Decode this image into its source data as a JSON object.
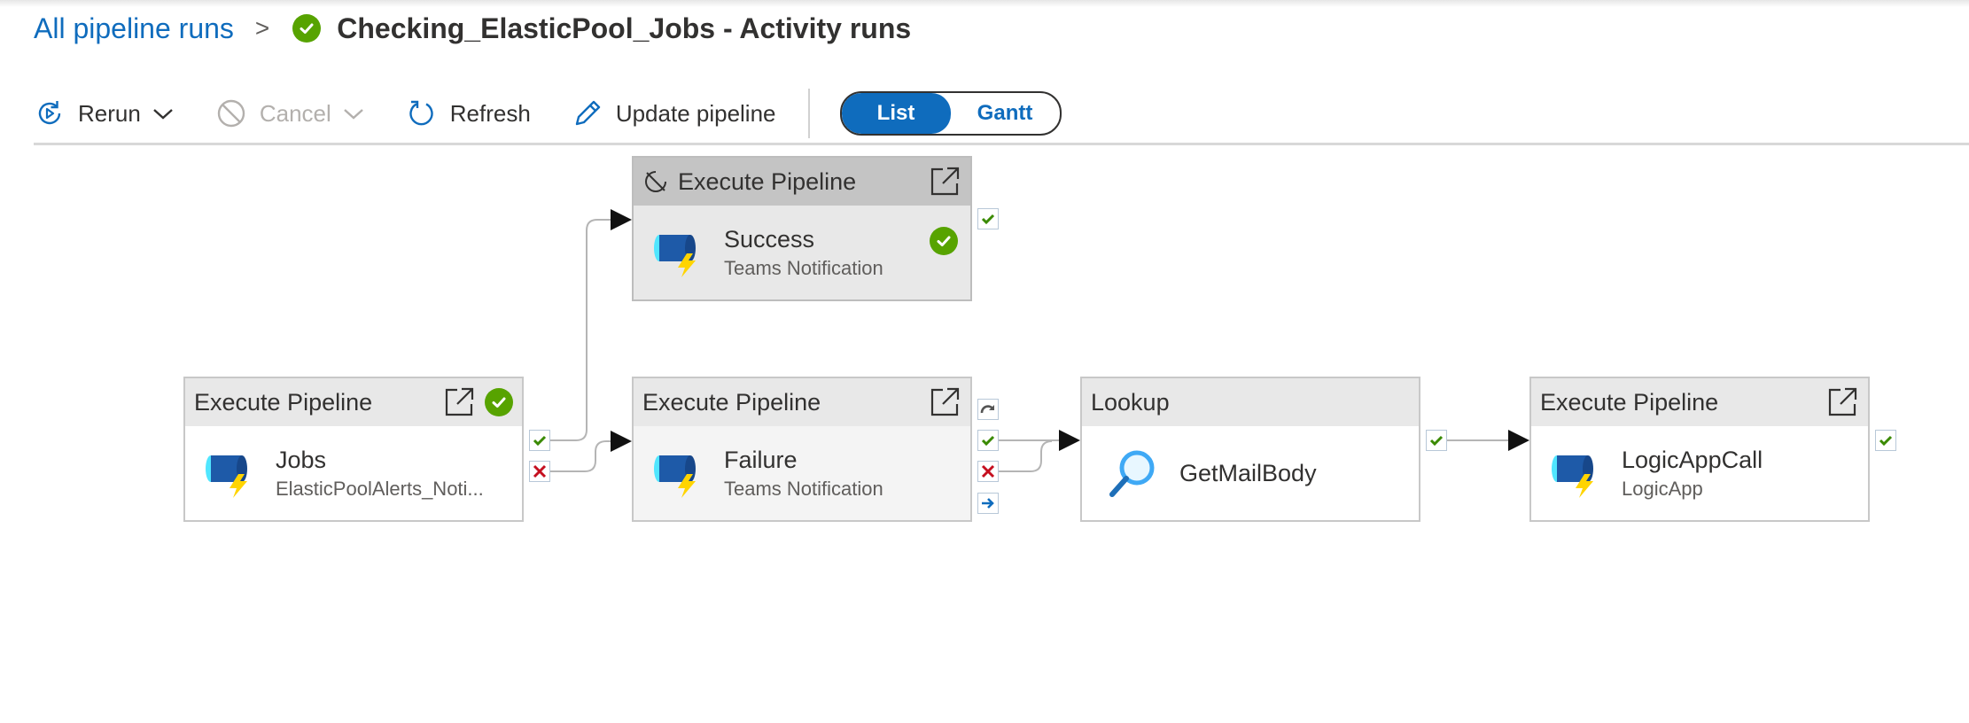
{
  "breadcrumb": {
    "root_link": "All pipeline runs",
    "separator": ">",
    "title": "Checking_ElasticPool_Jobs - Activity runs"
  },
  "toolbar": {
    "rerun": "Rerun",
    "cancel": "Cancel",
    "refresh": "Refresh",
    "update": "Update pipeline",
    "view_toggle": {
      "list": "List",
      "gantt": "Gantt",
      "selected": "List"
    }
  },
  "colors": {
    "accent": "#0f6cbd",
    "success": "#57a300",
    "failure": "#c50f1f"
  },
  "nodes": {
    "success": {
      "type": "Execute Pipeline",
      "name": "Success",
      "sub": "Teams Notification",
      "status": "succeeded"
    },
    "jobs": {
      "type": "Execute Pipeline",
      "name": "Jobs",
      "sub": "ElasticPoolAlerts_Noti...",
      "status": "succeeded"
    },
    "failure": {
      "type": "Execute Pipeline",
      "name": "Failure",
      "sub": "Teams Notification"
    },
    "lookup": {
      "type": "Lookup",
      "name": "GetMailBody"
    },
    "logic": {
      "type": "Execute Pipeline",
      "name": "LogicAppCall",
      "sub": "LogicApp"
    }
  },
  "icons": [
    "success-check-icon",
    "rerun-icon",
    "chevron-down-icon",
    "cancel-icon",
    "refresh-icon",
    "pencil-icon",
    "open-external-icon",
    "pipeline-icon",
    "lookup-icon",
    "deactivated-icon",
    "success-port-icon",
    "failure-port-icon",
    "completion-port-icon",
    "skipped-port-icon"
  ]
}
